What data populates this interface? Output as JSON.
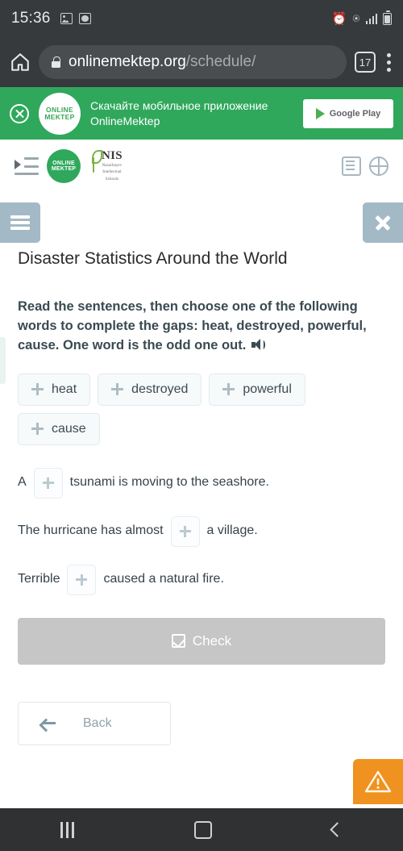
{
  "status_bar": {
    "time": "15:36",
    "left_icons": [
      "image-icon",
      "clock-icon"
    ],
    "right_icons": [
      "alarm-icon",
      "wifi-icon",
      "signal-icon",
      "battery-icon"
    ]
  },
  "browser": {
    "home_icon": "home-icon",
    "lock_icon": "lock-icon",
    "url_domain": "onlinemektep.org",
    "url_path": "/schedule/",
    "tab_count": "17",
    "menu_icon": "kebab-menu-icon"
  },
  "promo_banner": {
    "close_icon": "close-icon",
    "logo_line1": "ONLINE",
    "logo_line2": "MEKTEP",
    "text_line1": "Скачайте мобильное приложение",
    "text_line2": "OnlineMektep",
    "store_button_label": "Google Play",
    "background_color": "#2fa85c"
  },
  "site_header": {
    "toggle_icon": "sidebar-toggle-icon",
    "brand_logo_line1": "ONLINE",
    "brand_logo_line2": "MEKTEP",
    "nis_logo_main": "NIS",
    "nis_logo_sub1": "Nazarbayev",
    "nis_logo_sub2": "Intellectual",
    "nis_logo_sub3": "Schools",
    "list_icon": "list-icon",
    "language_icon": "globe-icon"
  },
  "lesson": {
    "menu_button_icon": "hamburger-icon",
    "close_button_icon": "close-x-icon",
    "button_color": "#a3b9c6",
    "title": "Disaster Statistics Around the World",
    "instructions": "Read the sentences, then choose one of the following words to complete the gaps: heat, destroyed, powerful, cause. One word is the odd one out.",
    "audio_icon": "speaker-icon",
    "word_chips": [
      {
        "label": "heat",
        "drag_icon": "move-icon"
      },
      {
        "label": "destroyed",
        "drag_icon": "move-icon"
      },
      {
        "label": "powerful",
        "drag_icon": "move-icon"
      },
      {
        "label": "cause",
        "drag_icon": "move-icon"
      }
    ],
    "sentences": [
      {
        "before": "A",
        "after": "tsunami is moving to the seashore.",
        "gap_icon": "drop-target-icon"
      },
      {
        "before": "The hurricane has almost",
        "after": "a village.",
        "gap_icon": "drop-target-icon"
      },
      {
        "before": "Terrible",
        "after": "caused a natural fire.",
        "gap_icon": "drop-target-icon"
      }
    ],
    "check_button": {
      "label": "Check",
      "icon": "checkbox-checked-icon",
      "color": "#c6c6c6"
    },
    "back_button": {
      "label": "Back",
      "icon": "arrow-left-icon"
    },
    "warning_button": {
      "icon": "warning-triangle-icon",
      "color": "#f0921f"
    }
  },
  "nav_bar": {
    "recent_icon": "recent-apps-icon",
    "home_icon": "home-square-icon",
    "back_icon": "back-chevron-icon"
  }
}
